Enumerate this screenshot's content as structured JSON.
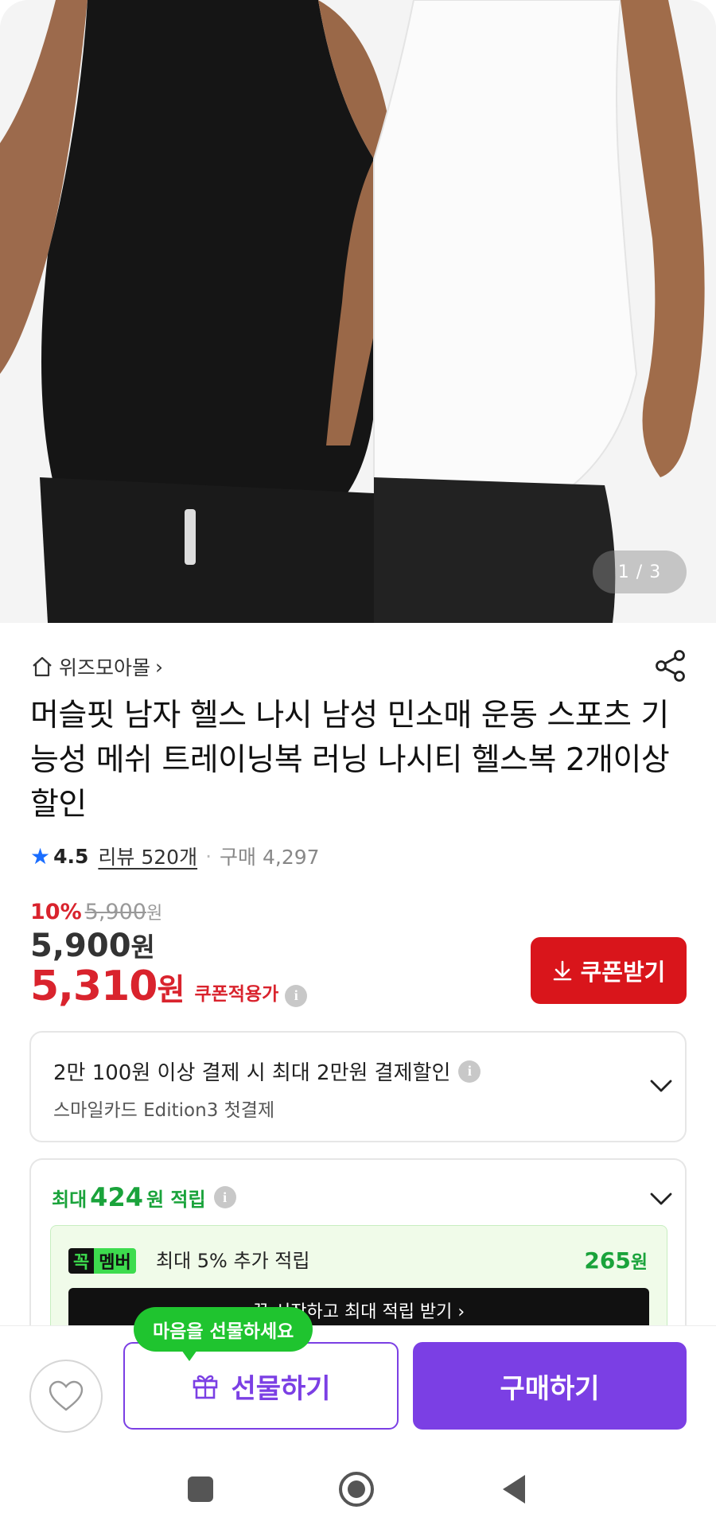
{
  "gallery": {
    "pager": "1 / 3"
  },
  "store": {
    "name": "위즈모아몰",
    "chevron": "›"
  },
  "product": {
    "title": "머슬핏 남자 헬스 나시 남성 민소매 운동 스포츠 기능성 메쉬 트레이닝복 러닝 나시티 헬스복 2개이상 할인",
    "rating": "4.5",
    "review_label": "리뷰 520개",
    "separator": "·",
    "purchase_label": "구매 4,297"
  },
  "price": {
    "discount_rate": "10%",
    "original_price": "5,900",
    "original_unit": "원",
    "sale_price": "5,900",
    "sale_unit": "원",
    "coupon_price": "5,310",
    "coupon_unit": "원",
    "coupon_price_label": "쿠폰적용가",
    "info": "i"
  },
  "coupon_button": {
    "label": "쿠폰받기"
  },
  "card_discount": {
    "title": "2만 100원 이상 결제 시 최대 2만원 결제할인",
    "subtitle": "스마일카드 Edition3 첫결제"
  },
  "rewards": {
    "prefix": "최대",
    "amount": "424",
    "suffix": "원 적립",
    "member_badge_1": "꼭",
    "member_badge_2": "멤버",
    "member_text": "최대 5% 추가 적립",
    "member_points": "265",
    "member_points_unit": "원",
    "member_cta": "꼭 시작하고 최대 적립 받기 ›"
  },
  "bottom": {
    "tooltip": "마음을 선물하세요",
    "gift_label": "선물하기",
    "buy_label": "구매하기"
  },
  "colors": {
    "accent_purple": "#7b3fe4",
    "sale_red": "#d9232d",
    "reward_green": "#1aa33b",
    "tooltip_green": "#1fc42f",
    "rating_star_blue": "#1a6dff"
  },
  "icons": [
    "home-icon",
    "share-icon",
    "star-icon",
    "info-icon",
    "download-icon",
    "chevron-down-icon",
    "heart-icon",
    "gift-icon",
    "square-nav-icon",
    "circle-nav-icon",
    "back-nav-icon"
  ]
}
